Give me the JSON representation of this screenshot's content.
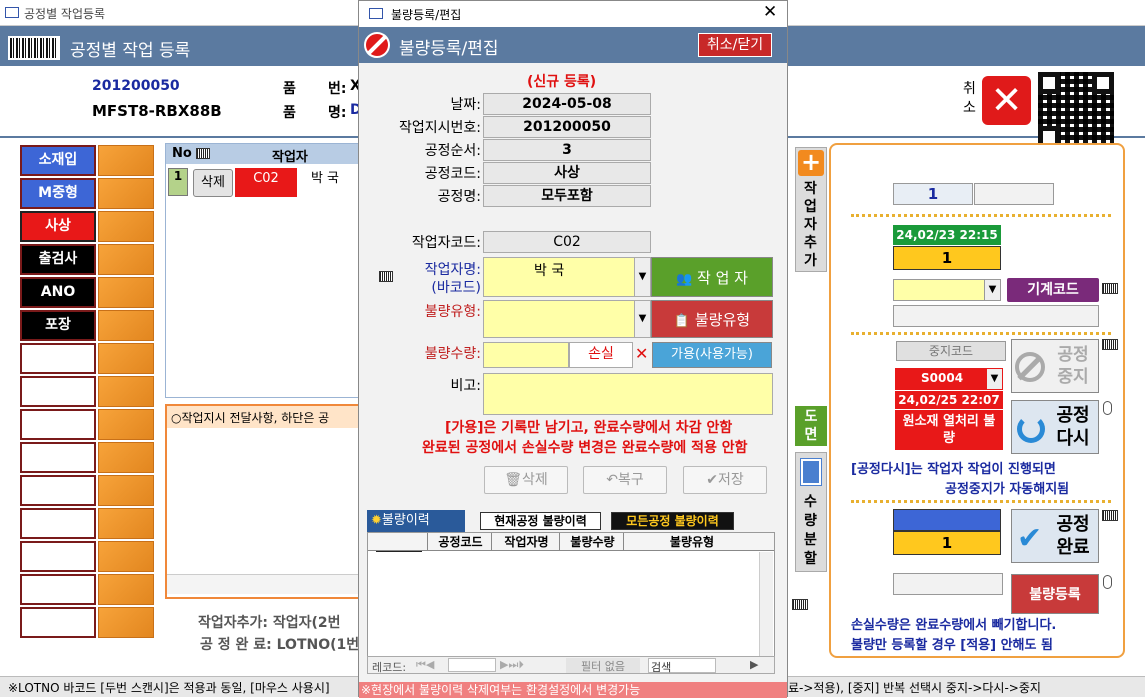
{
  "window": {
    "title": "공정별 작업등록"
  },
  "app": {
    "header": "공정별 작업 등록"
  },
  "info": {
    "order_no": "201200050",
    "part_code": "MFST8-RBX88B",
    "pum_label": "품",
    "beon_label": "번:",
    "myeong_label": "명:",
    "pum_val": "X",
    "myeong_val": "D"
  },
  "top_right": {
    "cancel_label": "취소"
  },
  "process_buttons": [
    "소재입",
    "M중형",
    "사상",
    "출검사",
    "ANO",
    "포장",
    "",
    "",
    "",
    "",
    "",
    "",
    "",
    "",
    ""
  ],
  "worker_table": {
    "col_no": "No",
    "col_worker": "작업자",
    "row_no": "1",
    "delete_label": "삭제",
    "code": "C02",
    "name": "박 국"
  },
  "note": {
    "text": "○작업지시 전달사항, 하단은 공"
  },
  "bottom_text": {
    "line1": "작업자추가: 작업자(2번",
    "line2": "공 정 완 료: LOTNO(1번"
  },
  "status": {
    "left": "※LOTNO 바코드 [두번 스캔시]은 적용과 동일, [마우스 사용시]",
    "right": "료->적용), [중지] 반복 선택시 중지->다시->중지"
  },
  "dialog": {
    "window_title": "불량등록/편집",
    "header_title": "불량등록/편집",
    "close_button": "취소/닫기",
    "mode": "(신규 등록)",
    "date_label": "날짜:",
    "date_value": "2024-05-08",
    "order_label": "작업지시번호:",
    "order_value": "201200050",
    "seq_label": "공정순서:",
    "seq_value": "3",
    "proc_code_label": "공정코드:",
    "proc_code_value": "사상",
    "proc_name_label": "공정명:",
    "proc_name_value": "모두포함",
    "worker_code_label": "작업자코드:",
    "worker_code_value": "C02",
    "worker_name_label1": "작업자명:",
    "worker_name_label2": "(바코드)",
    "worker_name_value": "박 국",
    "worker_button": "작 업 자",
    "defect_type_label": "불량유형:",
    "defect_type_button": "불량유형",
    "defect_qty_label": "불량수량:",
    "loss_label": "손실",
    "usable_button": "가용(사용가능)",
    "remark_label": "비고:",
    "warn1": "[가용]은 기록만 남기고, 완료수량에서 차감 안함",
    "warn2": "완료된 공정에서 손실수량 변경은 완료수량에 적용 안함",
    "delete_btn": "삭제",
    "restore_btn": "복구",
    "save_btn": "저장",
    "history_tab": "불량이력",
    "current_hist": "현재공정 불량이력",
    "all_hist": "모든공정 불량이력",
    "cols": [
      "공정코드",
      "작업자명",
      "불량수량",
      "불량유형"
    ],
    "nav_record": "레코드:",
    "nav_filter": "필터 없음",
    "nav_search": "검색",
    "footer": "※현장에서 불량이력 삭제여부는 환경설정에서 변경가능"
  },
  "side": {
    "add_worker": [
      "작",
      "업",
      "자",
      "추",
      "가"
    ],
    "drawing": [
      "도",
      "면"
    ],
    "split": [
      "수",
      "량",
      "분",
      "할"
    ]
  },
  "right_panel": {
    "box1": "1",
    "stamp_time": "24,02/23 22:15",
    "qty1": "1",
    "machine_btn": "기계코드",
    "stop_code_btn": "중지코드",
    "stop_code_value": "S0004",
    "stop_time": "24,02/25 22:07",
    "stop_reason": "원소재 열처리 불량",
    "stop_btn": "공정 중지",
    "restart_btn": "공정 다시",
    "note1": "[공정다시]는 작업자 작업이 진행되면",
    "note2": "공정중지가 자동해지됨",
    "qty2": "1",
    "complete_btn": "공정 완료",
    "defect_btn": "불량등록",
    "note3": "손실수량은 완료수량에서 빼기합니다.",
    "note4": "불량만 등록할 경우 [적용] 안해도 됨"
  },
  "colors": {
    "header_blue": "#5b7aa0",
    "orange": "#f0883a",
    "red": "#e01010",
    "green": "#5aa02a"
  }
}
